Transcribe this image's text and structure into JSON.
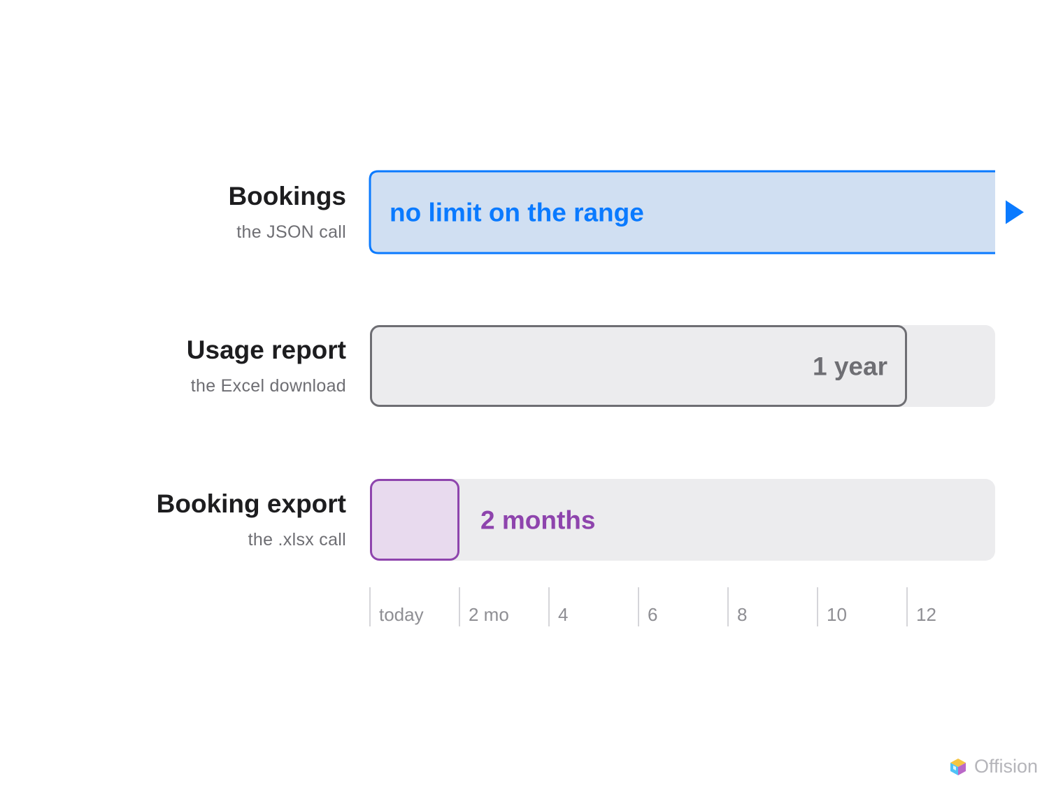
{
  "chart_data": {
    "type": "bar",
    "orientation": "horizontal",
    "x_unit": "months",
    "xlim": [
      0,
      14
    ],
    "ticks": [
      {
        "value": 0,
        "label": "today"
      },
      {
        "value": 2,
        "label": "2 mo"
      },
      {
        "value": 4,
        "label": "4"
      },
      {
        "value": 6,
        "label": "6"
      },
      {
        "value": 8,
        "label": "8"
      },
      {
        "value": 10,
        "label": "10"
      },
      {
        "value": 12,
        "label": "12"
      }
    ],
    "rows": [
      {
        "category": "Bookings",
        "subtitle": "the JSON call",
        "value": null,
        "unbounded": true,
        "bar_label": "no limit on the range",
        "color": "#0a7aff",
        "fill": "#d0dff2"
      },
      {
        "category": "Usage report",
        "subtitle": "the Excel download",
        "value": 12,
        "unbounded": false,
        "bar_label": "1 year",
        "color": "#6e6e73",
        "fill": "#ececee"
      },
      {
        "category": "Booking export",
        "subtitle": "the .xlsx call",
        "value": 2,
        "unbounded": false,
        "bar_label": "2 months",
        "color": "#8e44ad",
        "fill": "#e8daee"
      }
    ],
    "track_color": "#ececee",
    "grid": false
  },
  "brand": {
    "name": "Offision",
    "icon": "cube-logo-icon"
  }
}
